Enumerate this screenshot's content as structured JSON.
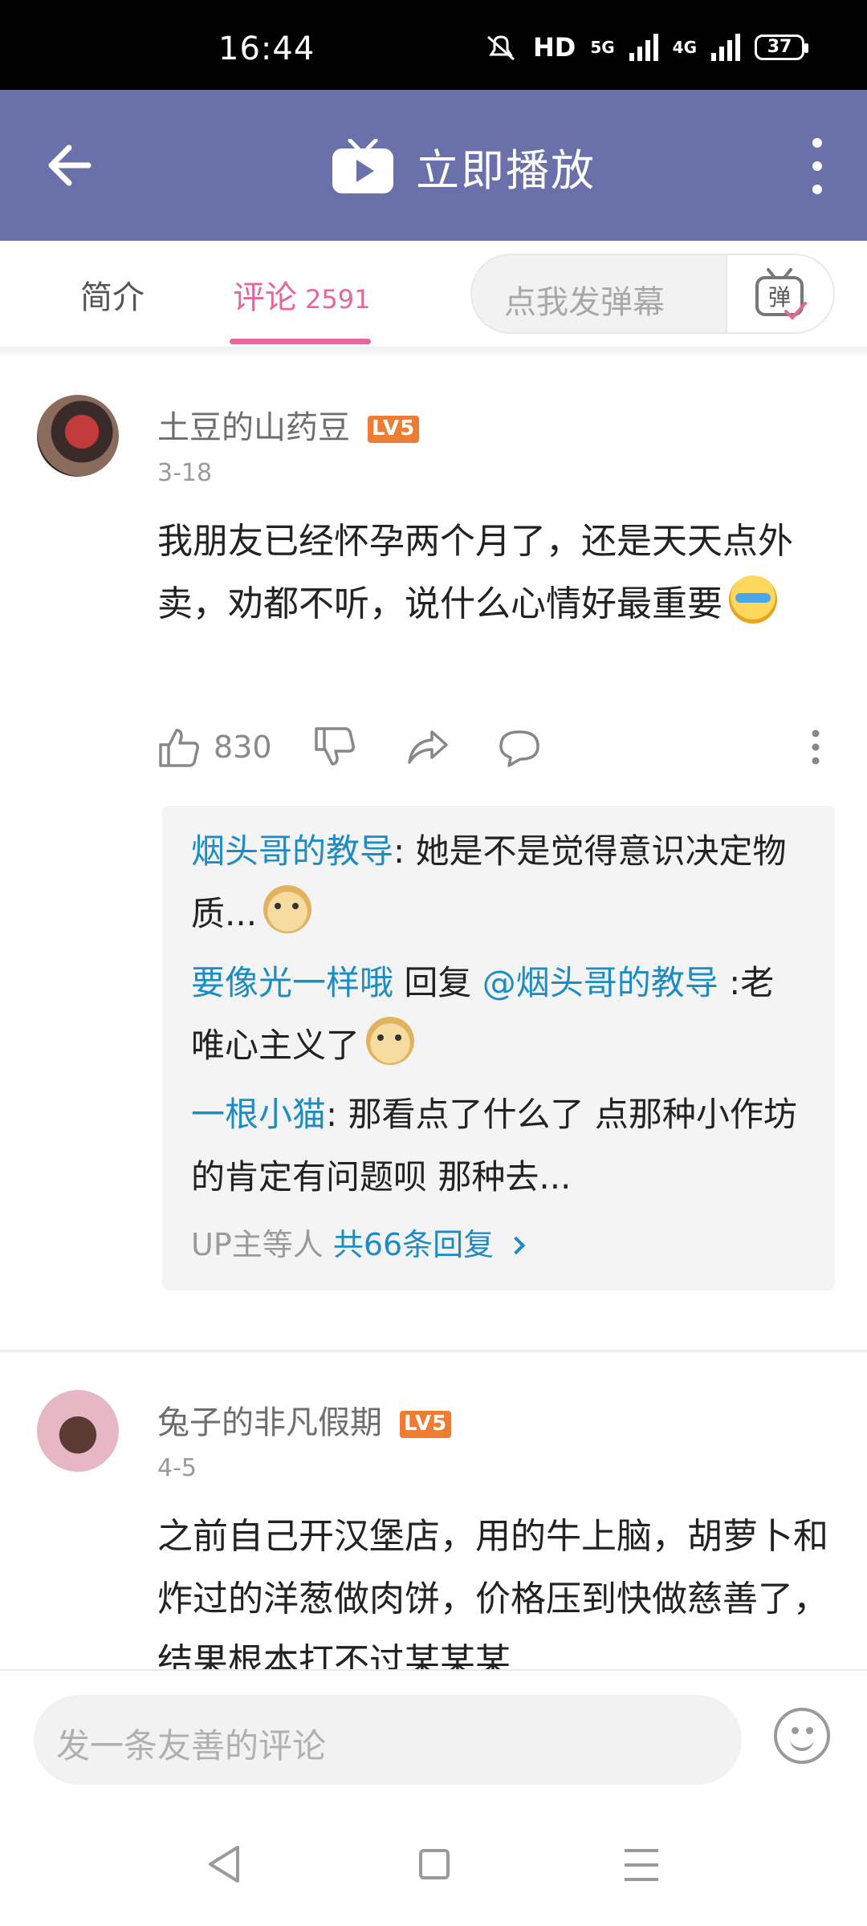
{
  "status_bar": {
    "time": "16:44",
    "network_hd": "HD",
    "network_5g": "5G",
    "network_4g": "4G",
    "battery": "37"
  },
  "header": {
    "title": "立即播放",
    "back_icon": "arrow-left-icon",
    "more_icon": "more-vertical-icon",
    "tv_icon": "tv-play-icon"
  },
  "tabs": {
    "intro": "简介",
    "comments": "评论",
    "comment_count": "2591"
  },
  "danmaku": {
    "placeholder": "点我发弹幕",
    "button_label": "弹"
  },
  "comments": [
    {
      "user": "土豆的山药豆",
      "level": "LV5",
      "date": "3-18",
      "text": "我朋友已经怀孕两个月了，还是天天点外卖，劝都不听，说什么心情好最重要",
      "likes": "830",
      "replies": [
        {
          "user": "烟头哥的教导",
          "sep": ": ",
          "text": "她是不是觉得意识决定物质..."
        },
        {
          "user": "要像光一样哦",
          "mid": " 回复 ",
          "mention": "@烟头哥的教导",
          "text": " :老唯心主义了"
        },
        {
          "user": "一根小猫",
          "sep": ": ",
          "text": "那看点了什么了   点那种小作坊的肯定有问题呗   那种去..."
        }
      ],
      "reply_footer_prefix": "UP主等人 ",
      "reply_footer_count": "共66条回复"
    },
    {
      "user": "兔子的非凡假期",
      "level": "LV5",
      "date": "4-5",
      "text": "之前自己开汉堡店，用的牛上脑，胡萝卜和炸过的洋葱做肉饼，价格压到快做慈善了，结果根本打不过某某某"
    }
  ],
  "bottom": {
    "placeholder": "发一条友善的评论"
  },
  "colors": {
    "header_bg": "#6a70a9",
    "accent_pink": "#e5679b",
    "link_blue": "#1e8cc4",
    "level_orange": "#ee7d33"
  }
}
